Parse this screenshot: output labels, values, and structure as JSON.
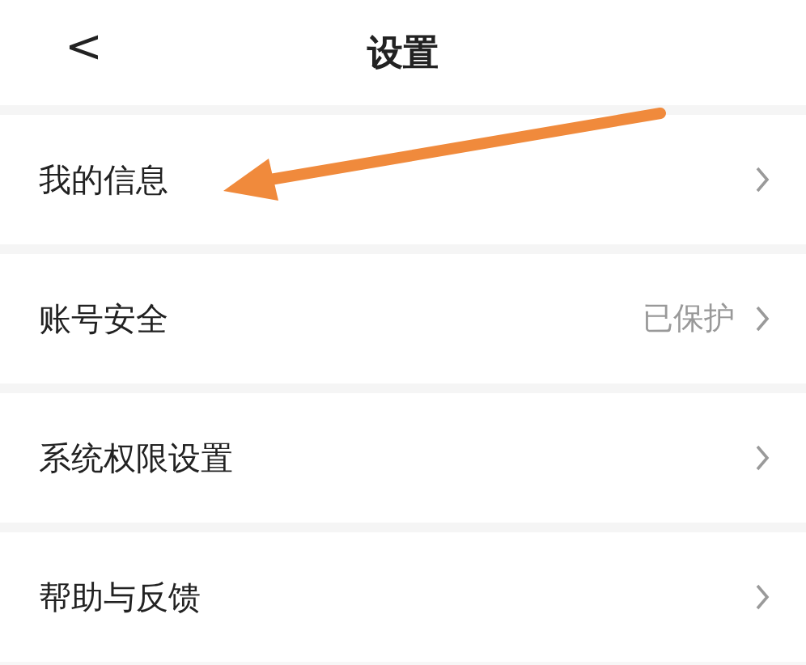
{
  "header": {
    "back": "<",
    "title": "设置"
  },
  "items": [
    {
      "label": "我的信息"
    },
    {
      "label": "账号安全",
      "value": "已保护"
    },
    {
      "label": "系统权限设置"
    },
    {
      "label": "帮助与反馈"
    }
  ],
  "annotation": {
    "kind": "arrow"
  }
}
